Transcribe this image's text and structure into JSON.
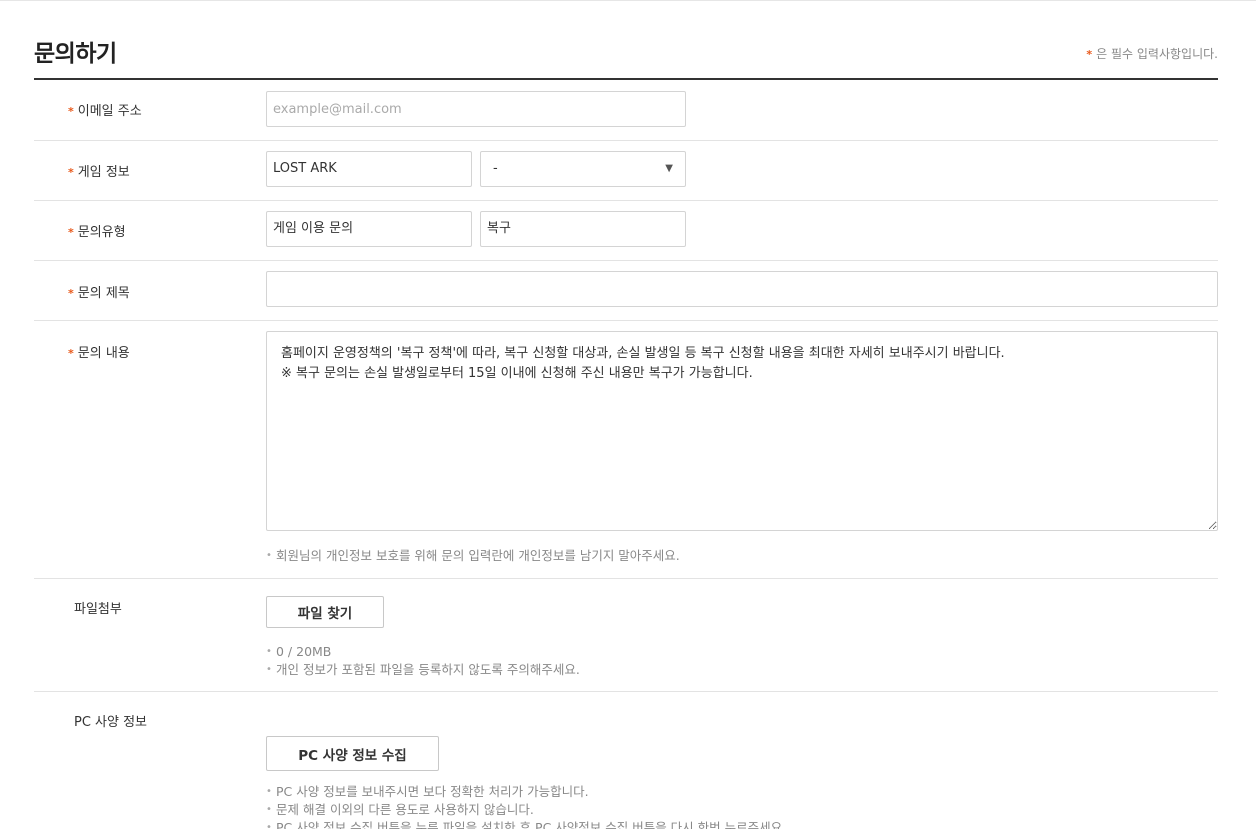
{
  "page_title": "문의하기",
  "required_note": "은 필수 입력사항입니다.",
  "required_star": "*",
  "email": {
    "label": "이메일 주소",
    "placeholder": "example@mail.com",
    "value": ""
  },
  "game": {
    "label": "게임 정보",
    "game_value": "LOST ARK",
    "server_value": "-",
    "dropdown_icon": "triangle-down-icon"
  },
  "inquiry_type": {
    "label": "문의유형",
    "category": "게임 이용 문의",
    "subcategory": "복구"
  },
  "subject": {
    "label": "문의 제목",
    "value": ""
  },
  "content": {
    "label": "문의 내용",
    "value": "홈페이지 운영정책의 '복구 정책'에 따라, 복구 신청할 대상과, 손실 발생일 등 복구 신청할 내용을 최대한 자세히 보내주시기 바랍니다.\n※ 복구 문의는 손실 발생일로부터 15일 이내에 신청해 주신 내용만 복구가 가능합니다.",
    "note": "회원님의 개인정보 보호를 위해 문의 입력란에 개인정보를 남기지 말아주세요."
  },
  "attachment": {
    "label": "파일첨부",
    "button": "파일 찾기",
    "notes": [
      "0 / 20MB",
      "개인 정보가 포함된 파일을 등록하지 않도록 주의해주세요."
    ]
  },
  "pc_spec": {
    "label": "PC 사양 정보",
    "button": "PC 사양 정보 수집",
    "notes": [
      "PC 사양 정보를 보내주시면 보다 정확한 처리가 가능합니다.",
      "문제 해결 이외의 다른 용도로 사용하지 않습니다.",
      "PC 사양 정보 수집 버튼을 누른 파일을 설치한 후 PC 사양정보 수집 버튼을 다시 한번 누르주세요."
    ]
  },
  "colors": {
    "accent_star": "#e8591b",
    "header_rule": "#333333"
  }
}
